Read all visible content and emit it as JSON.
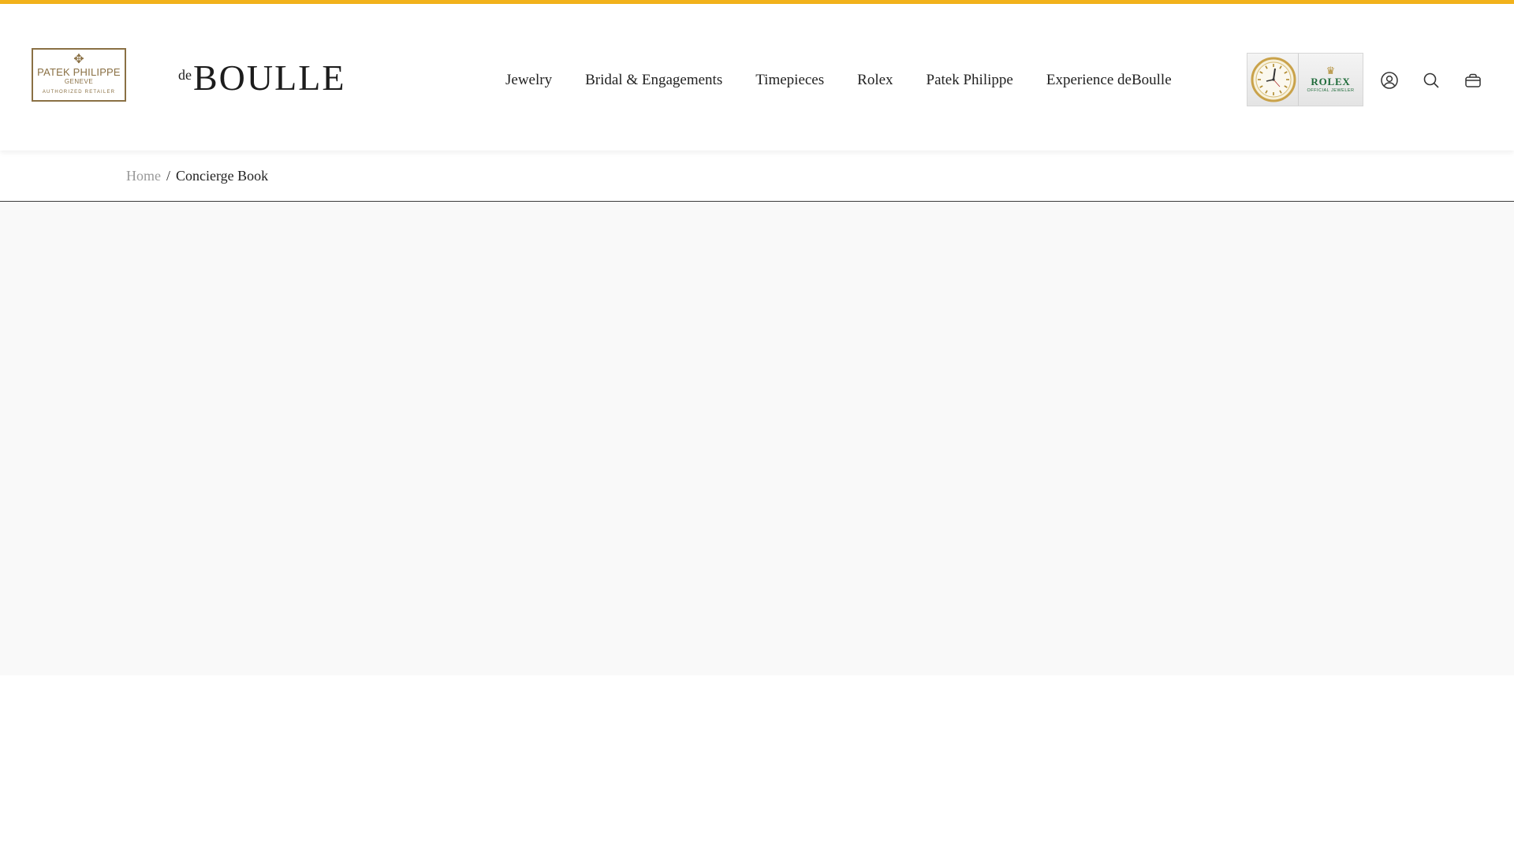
{
  "colors": {
    "accent_bar": "#f2b21b",
    "patek_gold": "#8a7044",
    "rolex_green": "#1f6b3a",
    "content_bg": "#f9f9f9"
  },
  "header": {
    "patek_badge": {
      "line1": "PATEK PHILIPPE",
      "line2": "GENEVE",
      "line3": "AUTHORIZED RETAILER",
      "icon": "calatrava-cross-icon"
    },
    "logo": {
      "prefix": "de",
      "name": "BOULLE"
    },
    "nav": [
      {
        "label": "Jewelry"
      },
      {
        "label": "Bridal & Engagements"
      },
      {
        "label": "Timepieces"
      },
      {
        "label": "Rolex"
      },
      {
        "label": "Patek Philippe"
      },
      {
        "label": "Experience deBoulle"
      }
    ],
    "rolex_plaque": {
      "crown_icon": "crown-icon",
      "name": "ROLEX",
      "tagline": "OFFICIAL JEWELER"
    },
    "icons": {
      "account": "user-circle-icon",
      "search": "search-icon",
      "cart": "shopping-bag-icon"
    }
  },
  "breadcrumb": {
    "home": "Home",
    "separator": "/",
    "current": "Concierge Book"
  }
}
